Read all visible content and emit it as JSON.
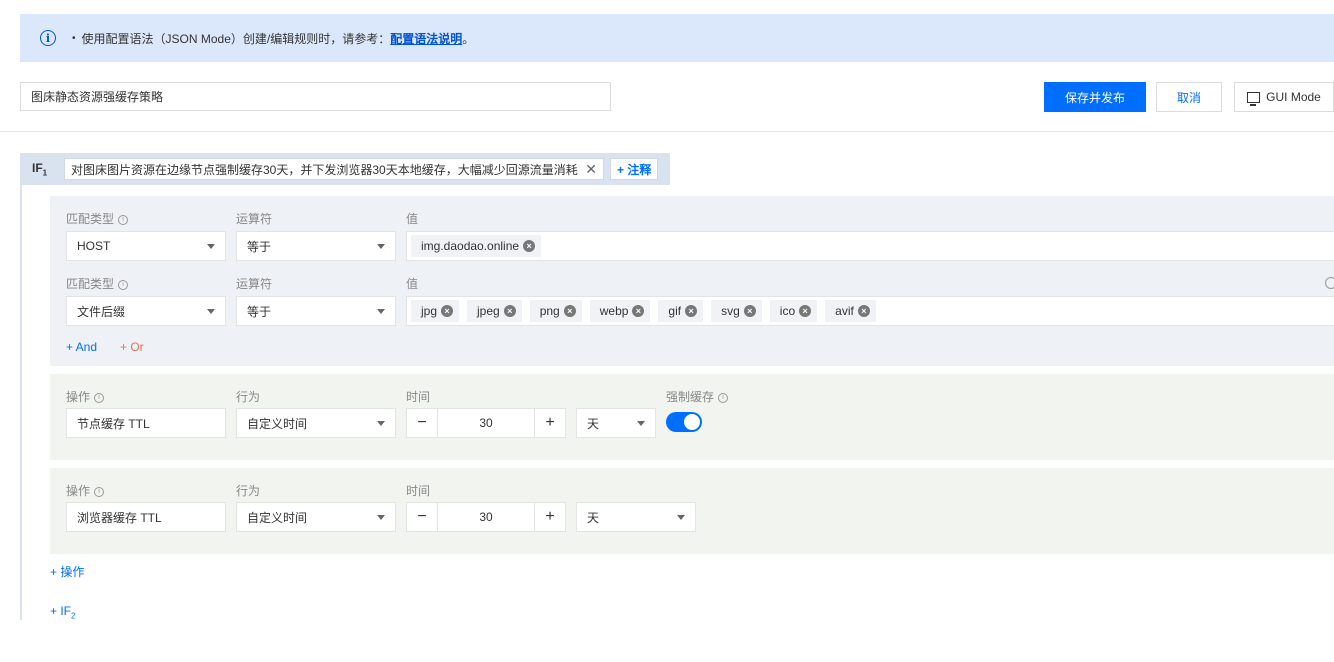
{
  "notice": {
    "bullet": "•",
    "text": "使用配置语法（JSON Mode）创建/编辑规则时，请参考：",
    "link": "配置语法说明",
    "suffix": "。"
  },
  "rule_name": "图床静态资源强缓存策略",
  "toolbar": {
    "publish_label": "保存并发布",
    "cancel_label": "取消",
    "gui_mode_label": "GUI Mode"
  },
  "if_block": {
    "label": "IF",
    "index": "1",
    "comment": "对图床图片资源在边缘节点强制缓存30天，并下发浏览器30天本地缓存，大幅减少回源流量消耗",
    "add_comment_label": "+ 注释"
  },
  "conditions": [
    {
      "match_type_label": "匹配类型",
      "operator_label": "运算符",
      "value_label": "值",
      "match_type": "HOST",
      "operator": "等于",
      "values": [
        "img.daodao.online"
      ]
    },
    {
      "match_type_label": "匹配类型",
      "operator_label": "运算符",
      "value_label": "值",
      "match_type": "文件后缀",
      "operator": "等于",
      "values": [
        "jpg",
        "jpeg",
        "png",
        "webp",
        "gif",
        "svg",
        "ico",
        "avif"
      ]
    }
  ],
  "and_label": "+ And",
  "or_label": "+ Or",
  "actions": [
    {
      "op_label": "操作",
      "behavior_label": "行为",
      "time_label": "时间",
      "force_label": "强制缓存",
      "operation": "节点缓存 TTL",
      "behavior": "自定义时间",
      "time_value": "30",
      "unit": "天",
      "force_cache": true
    },
    {
      "op_label": "操作",
      "behavior_label": "行为",
      "time_label": "时间",
      "operation": "浏览器缓存 TTL",
      "behavior": "自定义时间",
      "time_value": "30",
      "unit": "天"
    }
  ],
  "add_action_label": "+ 操作",
  "add_if": {
    "label": "+ IF",
    "index": "2"
  },
  "icons": {
    "info": "info-icon",
    "monitor": "monitor-icon",
    "close": "close-icon",
    "dropdown": "chevron-down-icon",
    "tag_remove": "remove-tag-icon",
    "help": "question-icon"
  },
  "colors": {
    "primary": "#006eff",
    "notice_bg": "#dbe8fb",
    "or_color": "#e8734a",
    "condition_bg": "#eef1f6",
    "action_bg": "#f1f4ef"
  }
}
